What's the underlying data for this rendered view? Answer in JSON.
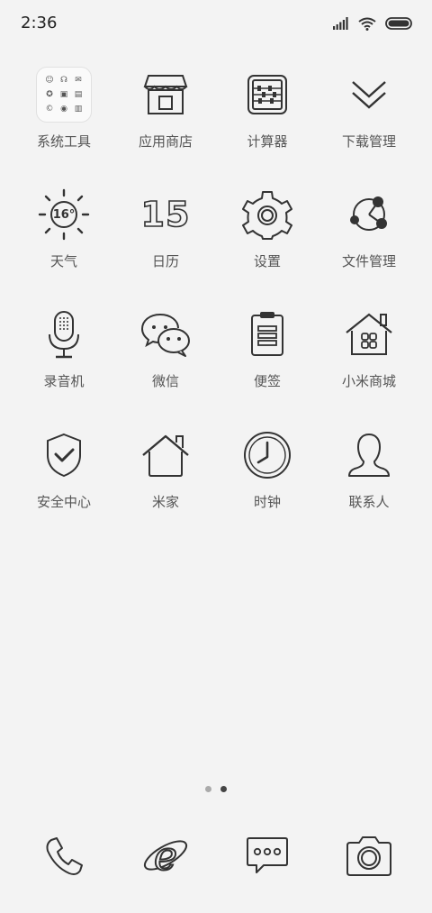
{
  "status": {
    "time": "2:36"
  },
  "apps": [
    {
      "label": "系统工具",
      "icon": "folder-icon"
    },
    {
      "label": "应用商店",
      "icon": "store-icon"
    },
    {
      "label": "计算器",
      "icon": "calculator-icon"
    },
    {
      "label": "下载管理",
      "icon": "download-icon"
    },
    {
      "label": "天气",
      "icon": "weather-icon",
      "temp": "16°"
    },
    {
      "label": "日历",
      "icon": "calendar-icon",
      "day": "15"
    },
    {
      "label": "设置",
      "icon": "gear-icon"
    },
    {
      "label": "文件管理",
      "icon": "file-manager-icon"
    },
    {
      "label": "录音机",
      "icon": "microphone-icon"
    },
    {
      "label": "微信",
      "icon": "wechat-icon"
    },
    {
      "label": "便签",
      "icon": "notes-icon"
    },
    {
      "label": "小米商城",
      "icon": "mi-store-icon"
    },
    {
      "label": "安全中心",
      "icon": "shield-icon"
    },
    {
      "label": "米家",
      "icon": "home-icon"
    },
    {
      "label": "时钟",
      "icon": "clock-icon"
    },
    {
      "label": "联系人",
      "icon": "contacts-icon"
    }
  ],
  "page_indicator": {
    "pages": 2,
    "current": 2
  },
  "dock": [
    {
      "name": "phone",
      "icon": "phone-icon"
    },
    {
      "name": "browser",
      "icon": "browser-icon"
    },
    {
      "name": "messages",
      "icon": "messages-icon"
    },
    {
      "name": "camera",
      "icon": "camera-icon"
    }
  ]
}
